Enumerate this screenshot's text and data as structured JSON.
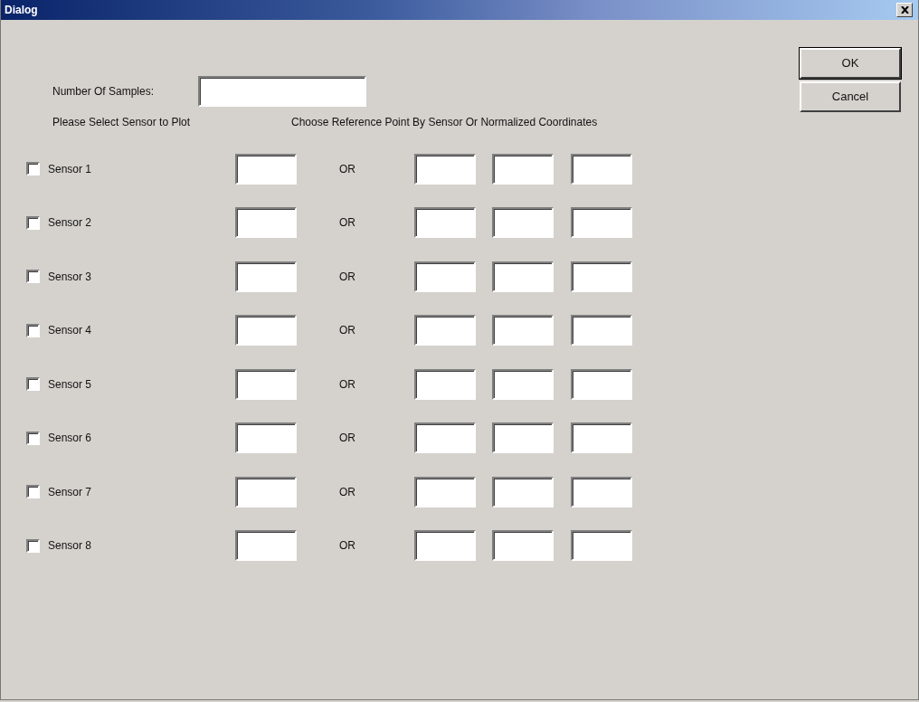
{
  "window": {
    "title": "Dialog"
  },
  "samples": {
    "label": "Number Of Samples:"
  },
  "buttons": [
    "OK",
    "Cancel"
  ],
  "sensor_heading": "Please Select Sensor to Plot",
  "reference_heading": "Choose Reference Point By Sensor Or Normalized Coordinates",
  "sensors": [
    {
      "label": "Sensor 1",
      "checked": false,
      "separator": "OR"
    },
    {
      "label": "Sensor 2",
      "checked": false,
      "separator": "OR"
    },
    {
      "label": "Sensor 3",
      "checked": false,
      "separator": "OR"
    },
    {
      "label": "Sensor 4",
      "checked": false,
      "separator": "OR"
    },
    {
      "label": "Sensor 5",
      "checked": false,
      "separator": "OR"
    },
    {
      "label": "Sensor 6",
      "checked": false,
      "separator": "OR"
    },
    {
      "label": "Sensor 7",
      "checked": false,
      "separator": "OR"
    },
    {
      "label": "Sensor 8",
      "checked": false,
      "separator": "OR"
    }
  ]
}
